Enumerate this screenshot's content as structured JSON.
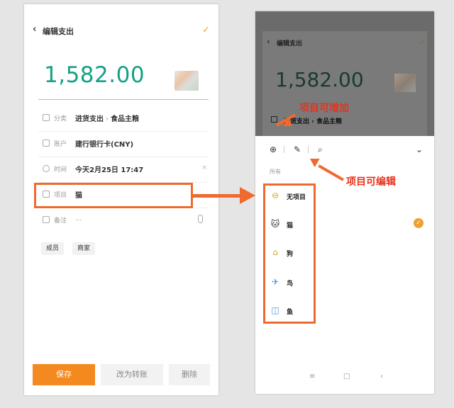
{
  "left": {
    "header": {
      "back_icon": "chevron-left-icon",
      "title": "编辑支出",
      "confirm_icon": "checkmark-icon"
    },
    "amount": "1,582.00",
    "rows": {
      "category": {
        "label": "分类",
        "value_main": "进货支出",
        "value_sub": "食品主粮"
      },
      "account": {
        "label": "账户",
        "value": "建行银行卡(CNY)"
      },
      "time": {
        "label": "时间",
        "value": "今天2月25日 17:47",
        "clear": "×"
      },
      "project": {
        "label": "项目",
        "value": "猫"
      },
      "note": {
        "label": "备注",
        "value": "..."
      }
    },
    "tags": [
      "成员",
      "商家"
    ],
    "buttons": {
      "save": "保存",
      "transfer": "改为转账",
      "delete": "删除"
    },
    "accent_color": "#f4891f",
    "amount_color": "#16a085"
  },
  "right": {
    "header": {
      "title": "编辑支出"
    },
    "amount": "1,582.00",
    "category": {
      "value_main": "进货支出",
      "value_sub": "食品主粮"
    },
    "toolbar": {
      "add_icon": "plus-circle-icon",
      "edit_icon": "edit-icon",
      "search_icon": "search-icon",
      "collapse_icon": "chevron-down-icon"
    },
    "section_label": "所有",
    "projects": [
      {
        "name": "无项目",
        "icon": "coin-icon",
        "glyph": "⊖",
        "selected": false
      },
      {
        "name": "猫",
        "icon": "cat-icon",
        "glyph": "🐱",
        "selected": true
      },
      {
        "name": "狗",
        "icon": "dog-house-icon",
        "glyph": "⌂",
        "selected": false
      },
      {
        "name": "鸟",
        "icon": "bird-plane-icon",
        "glyph": "✈",
        "selected": false
      },
      {
        "name": "鱼",
        "icon": "fish-tank-icon",
        "glyph": "◫",
        "selected": false
      }
    ],
    "nav": {
      "menu": "≡",
      "home": "□",
      "back": "‹"
    }
  },
  "annotations": {
    "add_note": "项目可增加",
    "edit_note": "项目可编辑",
    "color": "#e8321c"
  }
}
